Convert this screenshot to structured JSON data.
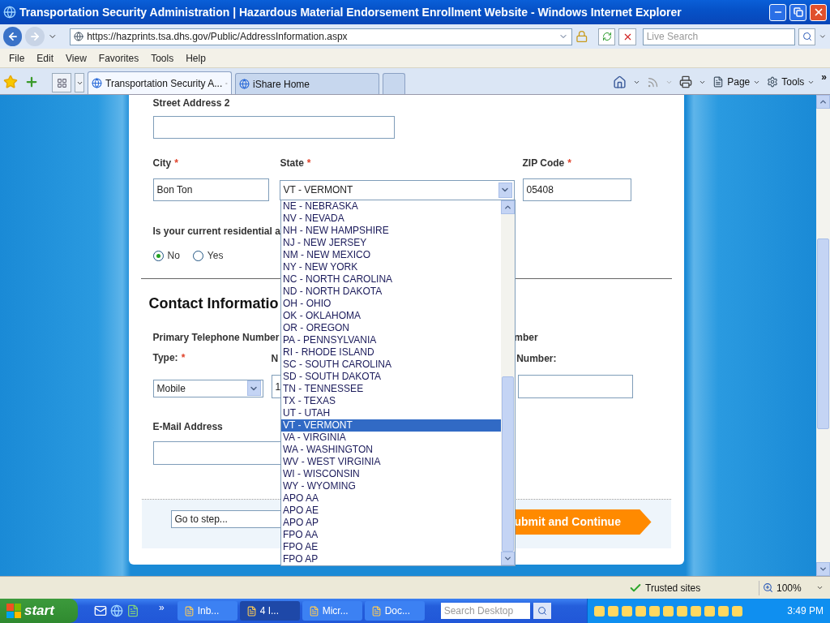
{
  "window": {
    "title": "Transportation Security Administration | Hazardous Material Endorsement Enrollment Website - Windows Internet Explorer"
  },
  "nav": {
    "url": "https://hazprints.tsa.dhs.gov/Public/AddressInformation.aspx",
    "search_placeholder": "Live Search"
  },
  "menu": [
    "File",
    "Edit",
    "View",
    "Favorites",
    "Tools",
    "Help"
  ],
  "tabs": [
    {
      "label": "Transportation Security A...",
      "selected": true
    },
    {
      "label": "iShare Home",
      "selected": false
    }
  ],
  "command_bar": {
    "buttons": [
      "Page",
      "Tools"
    ],
    "overflow": "»"
  },
  "form": {
    "street2_label": "Street Address 2",
    "city": {
      "label": "City",
      "mark": "*",
      "value": "Bon Ton"
    },
    "state": {
      "label": "State",
      "mark": "*",
      "value": "VT - VERMONT"
    },
    "zip": {
      "label": "ZIP Code",
      "mark": "*",
      "value": "05408"
    },
    "question": "Is your current residential a",
    "options": [
      {
        "label": "No",
        "selected": true
      },
      {
        "label": "Yes",
        "selected": false
      }
    ],
    "contact_heading": "Contact Informatio",
    "primary_label": "Primary Telephone Number",
    "secondary_label": "mber",
    "type": {
      "label": "Type:",
      "mark": "*",
      "value": "Mobile"
    },
    "number_label": "N",
    "number_value": "1",
    "secondary_number_label": "Number:",
    "email_label": "E-Mail Address",
    "go_to_step": "Go to step...",
    "submit": "ubmit and Continue"
  },
  "dropdown": {
    "items": [
      {
        "label": "NE - NEBRASKA",
        "selected": false
      },
      {
        "label": "NV - NEVADA",
        "selected": false
      },
      {
        "label": "NH - NEW HAMPSHIRE",
        "selected": false
      },
      {
        "label": "NJ - NEW JERSEY",
        "selected": false
      },
      {
        "label": "NM - NEW MEXICO",
        "selected": false
      },
      {
        "label": "NY - NEW YORK",
        "selected": false
      },
      {
        "label": "NC - NORTH CAROLINA",
        "selected": false
      },
      {
        "label": "ND - NORTH DAKOTA",
        "selected": false
      },
      {
        "label": "OH - OHIO",
        "selected": false
      },
      {
        "label": "OK - OKLAHOMA",
        "selected": false
      },
      {
        "label": "OR - OREGON",
        "selected": false
      },
      {
        "label": "PA - PENNSYLVANIA",
        "selected": false
      },
      {
        "label": "RI - RHODE ISLAND",
        "selected": false
      },
      {
        "label": "SC - SOUTH CAROLINA",
        "selected": false
      },
      {
        "label": "SD - SOUTH DAKOTA",
        "selected": false
      },
      {
        "label": "TN - TENNESSEE",
        "selected": false
      },
      {
        "label": "TX - TEXAS",
        "selected": false
      },
      {
        "label": "UT - UTAH",
        "selected": false
      },
      {
        "label": "VT - VERMONT",
        "selected": true
      },
      {
        "label": "VA - VIRGINIA",
        "selected": false
      },
      {
        "label": "WA - WASHINGTON",
        "selected": false
      },
      {
        "label": "WV - WEST VIRGINIA",
        "selected": false
      },
      {
        "label": "WI - WISCONSIN",
        "selected": false
      },
      {
        "label": "WY - WYOMING",
        "selected": false
      },
      {
        "label": "APO AA",
        "selected": false
      },
      {
        "label": "APO AE",
        "selected": false
      },
      {
        "label": "APO AP",
        "selected": false
      },
      {
        "label": "FPO AA",
        "selected": false
      },
      {
        "label": "FPO AE",
        "selected": false
      },
      {
        "label": "FPO AP",
        "selected": false
      }
    ]
  },
  "status_bar": {
    "zone": "Trusted sites",
    "zoom": "100%"
  },
  "taskbar": {
    "start": "start",
    "overflow": "»",
    "tasks": [
      {
        "label": "Inb...",
        "selected": false
      },
      {
        "label": "4 I...",
        "selected": true
      },
      {
        "label": "Micr...",
        "selected": false
      },
      {
        "label": "Doc...",
        "selected": false
      }
    ],
    "search_placeholder": "Search Desktop",
    "clock": "3:49 PM"
  }
}
